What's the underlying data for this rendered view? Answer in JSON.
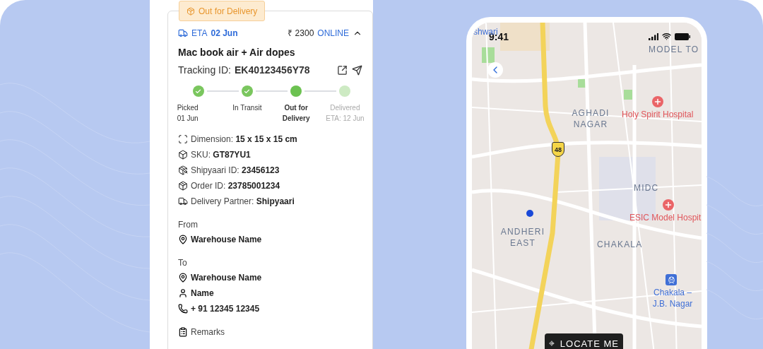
{
  "status_badge": "Out for Delivery",
  "shipment": {
    "eta_label": "ETA",
    "eta_date": "02 Jun",
    "amount": "₹ 2300",
    "payment_mode": "ONLINE",
    "expanded": true,
    "title": "Mac book air + Air dopes",
    "tracking_label": "Tracking ID:",
    "tracking_id": "EK40123456Y78"
  },
  "steps": [
    {
      "label": "Picked",
      "sub": "01 Jun",
      "completed": true,
      "current": false
    },
    {
      "label": "In Transit",
      "completed": true,
      "current": false
    },
    {
      "label": "Out for Delivery",
      "completed": false,
      "current": true
    },
    {
      "label": "Delivered",
      "sub": "ETA: 12 Jun",
      "completed": false,
      "current": false
    }
  ],
  "details": [
    {
      "kind": "dimension",
      "label": "Dimension:",
      "value": "15 x 15 x 15 cm"
    },
    {
      "kind": "sku",
      "label": "SKU:",
      "value": "GT87YU1"
    },
    {
      "kind": "shipyaari",
      "label": "Shipyaari ID:",
      "value": "23456123"
    },
    {
      "kind": "order",
      "label": "Order ID:",
      "value": "23785001234"
    },
    {
      "kind": "partner",
      "label": "Delivery Partner:",
      "value": "Shipyaari"
    }
  ],
  "from": {
    "heading": "From",
    "address": "Warehouse Name"
  },
  "to": {
    "heading": "To",
    "address": "Warehouse Name",
    "name": "Name",
    "phone": "+ 91 12345 12345"
  },
  "remarks": "Remarks",
  "map": {
    "time": "9:41",
    "highway": "48",
    "button": "LOCATE ME",
    "labels": [
      {
        "kind": "edge",
        "text": "shwari"
      },
      {
        "kind": "area",
        "text": "MODEL TO"
      },
      {
        "kind": "area",
        "text": "AGHADI NAGAR"
      },
      {
        "kind": "hospital",
        "text": "Holy Spirit Hospital"
      },
      {
        "kind": "area",
        "text": "MIDC"
      },
      {
        "kind": "hospital",
        "text": "ESIC Model Hospit"
      },
      {
        "kind": "area",
        "text": "ANDHERI EAST"
      },
      {
        "kind": "area",
        "text": "CHAKALA"
      },
      {
        "kind": "station",
        "text": "Chakala – J.B. Nagar"
      }
    ]
  }
}
